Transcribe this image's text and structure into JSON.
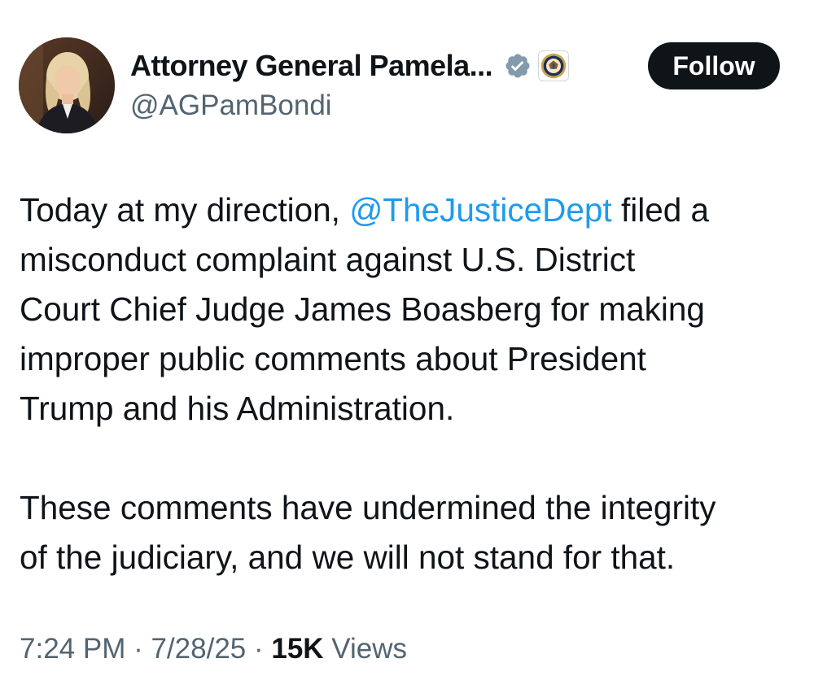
{
  "author": {
    "display_name": "Attorney General Pamela...",
    "handle": "@AGPamBondi",
    "verified_badge_color": "#829aab",
    "affiliate_icon": "doj-seal-icon"
  },
  "follow_label": "Follow",
  "tweet": {
    "line1_pre": "Today at my direction, ",
    "mention": "@TheJusticeDept",
    "line1_post": " filed a",
    "line2": "misconduct complaint against U.S. District",
    "line3": "Court Chief Judge James Boasberg for making",
    "line4": "improper public comments about President",
    "line5": "Trump and his Administration.",
    "line6": "These comments have undermined the integrity",
    "line7": "of the judiciary, and we will not stand for that."
  },
  "meta": {
    "time": "7:24 PM",
    "sep1": " · ",
    "date": "7/28/25",
    "sep2": " · ",
    "views_count": "15K",
    "views_label": " Views"
  },
  "colors": {
    "text": "#0f1419",
    "secondary": "#536471",
    "link": "#1d9bf0",
    "button_bg": "#0f1419"
  }
}
